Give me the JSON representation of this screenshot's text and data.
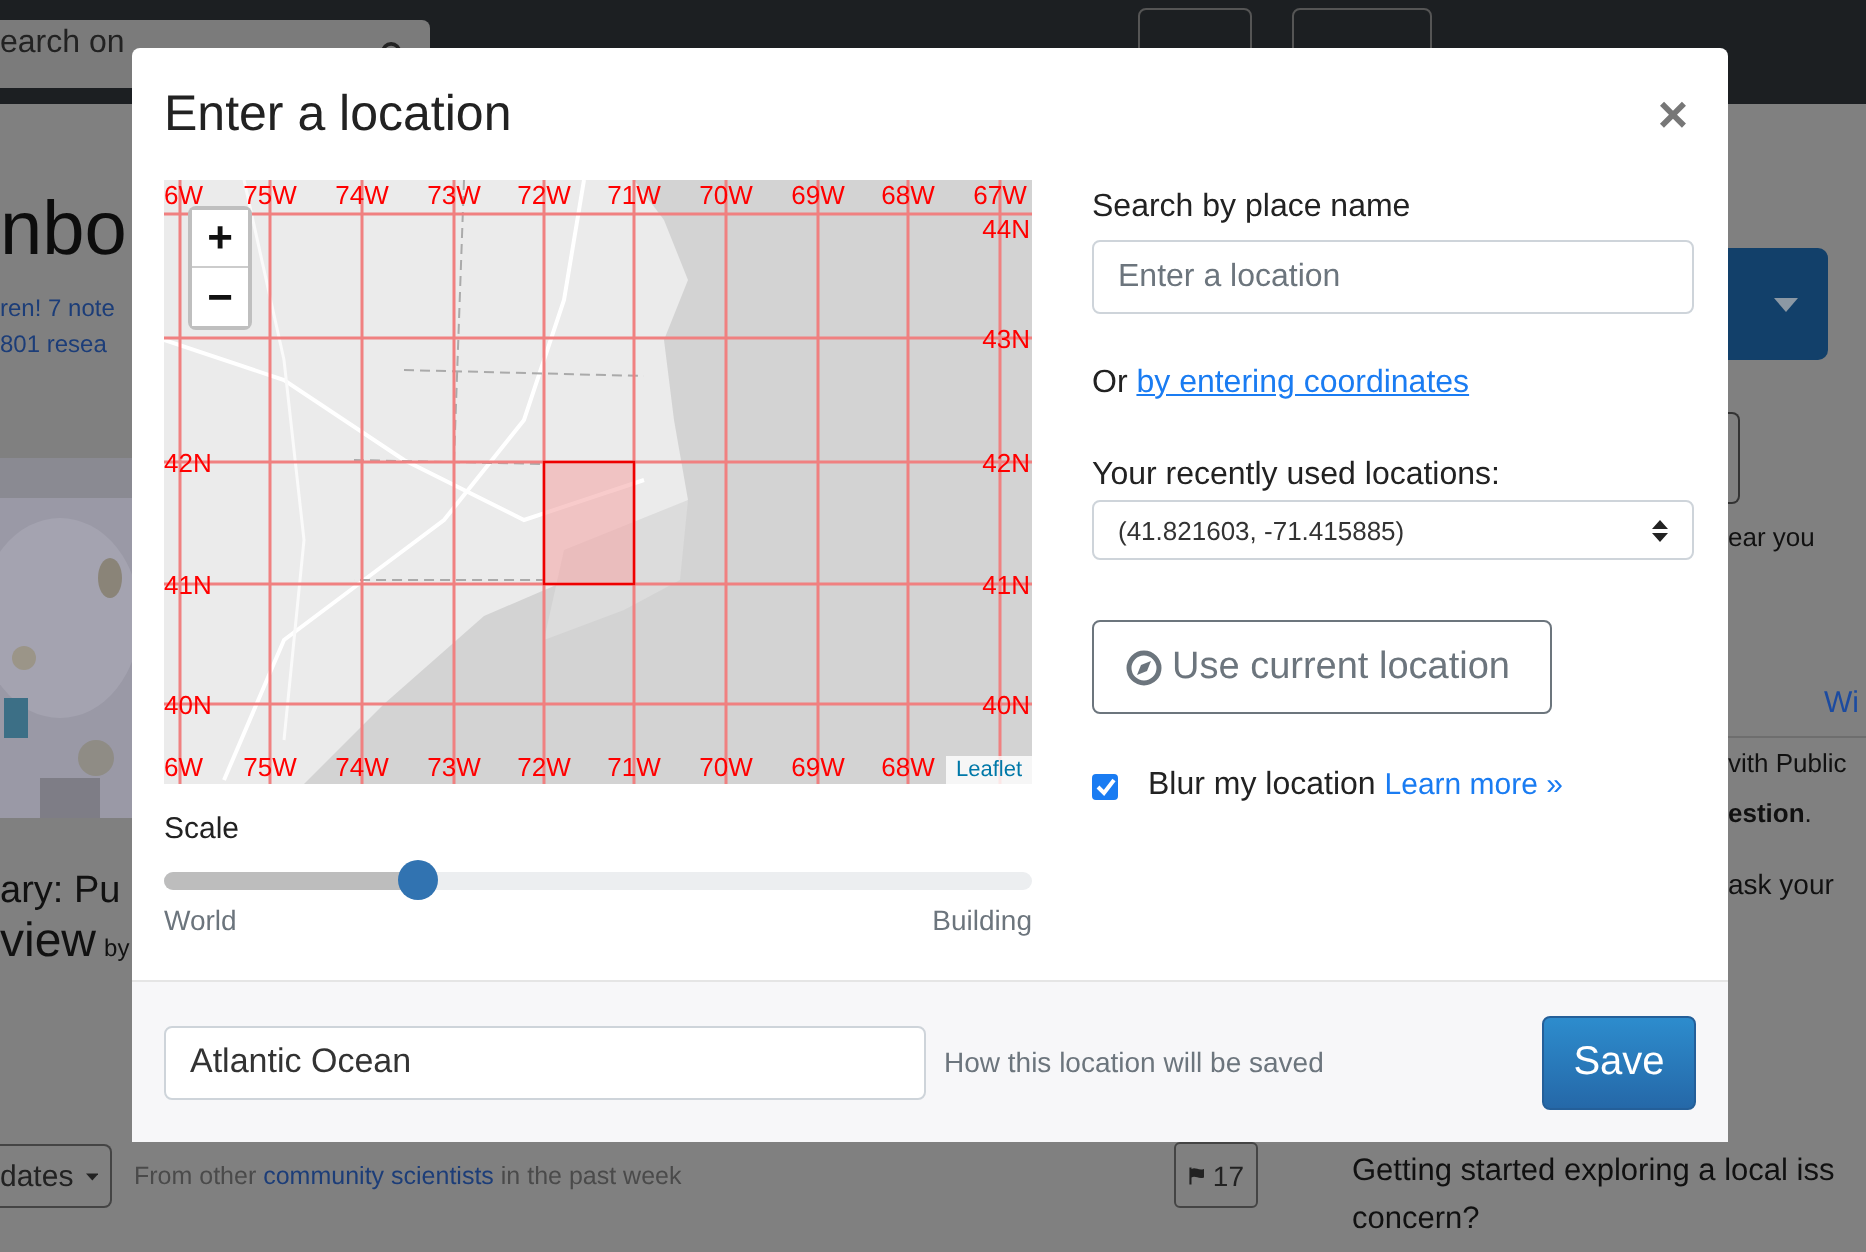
{
  "background_page": {
    "search": {
      "value": "earch on"
    },
    "left": {
      "title": "nbo",
      "stats": [
        "ren! 7 note",
        "801 resea"
      ],
      "story_title": "ary: Pu",
      "story_title_2": "view",
      "story_byline": "by"
    },
    "right": {
      "nearby": "ear you",
      "tab_link": "Wi",
      "intro": [
        "vith Public",
        "**estion**."
      ],
      "ask": "ask your"
    },
    "feed": {
      "filter": "dates",
      "note_before": "From other",
      "note_link": "community scientists",
      "note_after": "in the past week",
      "flag_count": "17",
      "question": [
        "Getting started exploring a local iss",
        "concern?"
      ]
    }
  },
  "modal": {
    "title": "Enter a location",
    "close": "×",
    "map": {
      "zoom_in": "+",
      "zoom_out": "−",
      "attribution": "Leaflet",
      "grid_top": [
        "6W",
        "75W",
        "74W",
        "73W",
        "72W",
        "71W",
        "70W",
        "69W",
        "68W",
        "67W"
      ],
      "grid_bottom": [
        "6W",
        "75W",
        "74W",
        "73W",
        "72W",
        "71W",
        "70W",
        "69W",
        "68W"
      ],
      "grid_left": [
        "42N",
        "41N",
        "40N"
      ],
      "grid_right": [
        "44N",
        "43N",
        "42N",
        "41N",
        "40N"
      ]
    },
    "scale": {
      "label": "Scale",
      "level": 0.29,
      "min_label": "World",
      "max_label": "Building"
    },
    "search": {
      "label": "Search by place name",
      "placeholder": "Enter a location"
    },
    "coords": {
      "prefix": "Or",
      "link": "by entering coordinates"
    },
    "recent": {
      "label": "Your recently used locations:",
      "value": "(41.821603, -71.415885)"
    },
    "current_location": "Use current location",
    "blur": {
      "checked": true,
      "label": "Blur my location",
      "link": "Learn more »"
    },
    "footer": {
      "name_value": "Atlantic Ocean",
      "hint": "How this location will be saved",
      "save": "Save"
    }
  }
}
